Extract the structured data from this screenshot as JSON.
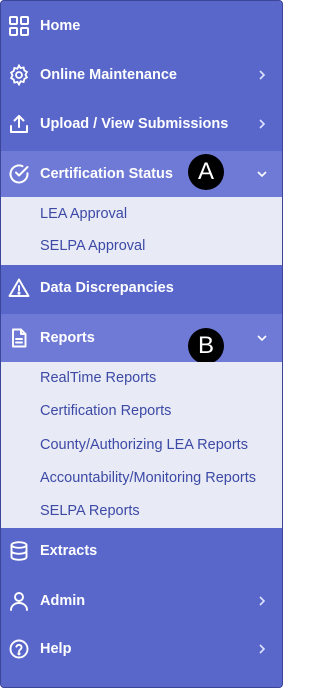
{
  "nav": {
    "home": "Home",
    "online_maintenance": "Online Maintenance",
    "upload": "Upload / View Submissions",
    "certification": "Certification Status",
    "certification_sub": [
      "LEA Approval",
      "SELPA Approval"
    ],
    "data_discrepancies": "Data Discrepancies",
    "reports": "Reports",
    "reports_sub": [
      "RealTime Reports",
      "Certification Reports",
      "County/Authorizing LEA Reports",
      "Accountability/Monitoring Reports",
      "SELPA Reports"
    ],
    "extracts": "Extracts",
    "admin": "Admin",
    "help": "Help"
  },
  "callouts": {
    "a": "A",
    "b": "B"
  },
  "colors": {
    "sidebar_bg": "#5967cb",
    "active_bg": "#6f7ad6",
    "submenu_bg": "#e8eaf5",
    "submenu_text": "#3c4aa6"
  }
}
